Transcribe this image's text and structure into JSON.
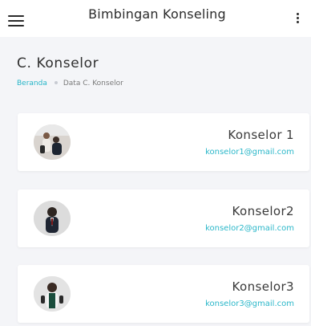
{
  "header": {
    "title": "Bimbingan Konseling",
    "menu_icon": "hamburger-menu-icon",
    "more_icon": "vertical-dots-icon"
  },
  "page": {
    "title": "C. Konselor",
    "breadcrumb": {
      "home": "Beranda",
      "current": "Data C. Konselor"
    }
  },
  "counselors": [
    {
      "name": "Konselor 1",
      "email": "konselor1@gmail.com"
    },
    {
      "name": "Konselor2",
      "email": "konselor2@gmail.com"
    },
    {
      "name": "Konselor3",
      "email": "konselor3@gmail.com"
    }
  ],
  "colors": {
    "accent": "#27b6c8",
    "background": "#f4f5f8",
    "card": "#ffffff",
    "text": "#2f2f2f"
  }
}
